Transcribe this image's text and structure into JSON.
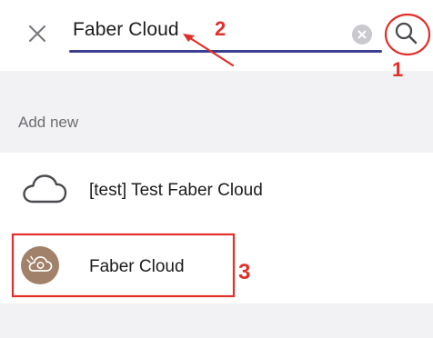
{
  "search": {
    "query": "Faber Cloud"
  },
  "section": {
    "title": "Add new"
  },
  "list": [
    {
      "label": "[test] Test Faber Cloud",
      "icon": "cloud-outline-icon"
    },
    {
      "label": "Faber Cloud",
      "icon": "faber-cloud-avatar-icon"
    }
  ],
  "annotations": {
    "one": "1",
    "two": "2",
    "three": "3",
    "color": "#e0302a"
  },
  "colors": {
    "accent_underline": "#3b3f8f",
    "background": "#f2f2f4",
    "avatar_brown": "#a1816a"
  }
}
